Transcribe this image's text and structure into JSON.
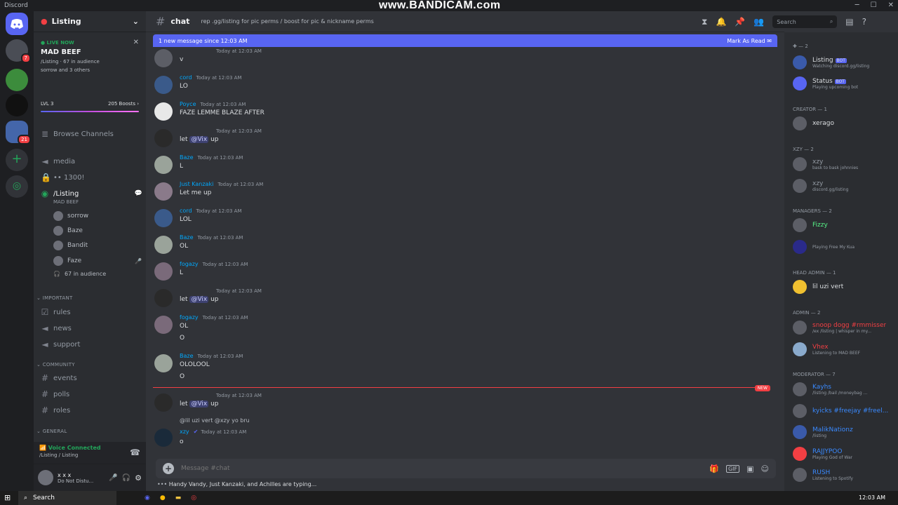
{
  "window": {
    "app_title": "Discord",
    "watermark": "www.BANDICAM.com"
  },
  "server_list": {
    "badges": [
      "7",
      "21"
    ]
  },
  "guild": {
    "name": "Listing"
  },
  "live_stage": {
    "tag": "LIVE NOW",
    "title": "MAD BEEF",
    "channel": "/Listing",
    "audience": "67 in audience",
    "speakers": "sorrow and 3 others"
  },
  "boost": {
    "level": "LVL 3",
    "boosts": "205 Boosts"
  },
  "channels": {
    "browse": "Browse Channels",
    "media": "media",
    "locked": "•• 1300!",
    "stage": "/Listing",
    "stage_sub": "MAD BEEF",
    "speakers": [
      "sorrow",
      "Baze",
      "Bandit",
      "Faze"
    ],
    "audience": "67 in audience",
    "cat_important": "IMPORTANT",
    "rules": "rules",
    "news": "news",
    "support": "support",
    "cat_community": "COMMUNITY",
    "events": "events",
    "polls": "polls",
    "roles": "roles",
    "cat_general": "GENERAL"
  },
  "voice_panel": {
    "status": "Voice Connected",
    "location": "/Listing / Listing"
  },
  "user_panel": {
    "name": "x x x",
    "status": "Do Not Distu..."
  },
  "chat": {
    "channel": "chat",
    "topic": "rep .gg/listing for pic perms / boost for pic & nickname perms",
    "new_messages": "1 new message since 12:03 AM",
    "mark_read": "Mark As Read",
    "new_tag": "NEW",
    "placeholder": "Message #chat",
    "typing": "Handy Vandy, Just Kanzaki, and Achilles are typing..."
  },
  "messages": [
    {
      "author": "",
      "time": "Today at 12:03 AM",
      "text": "v"
    },
    {
      "author": "cord",
      "time": "Today at 12:03 AM",
      "text": "LO"
    },
    {
      "author": "Poyce",
      "time": "Today at 12:03 AM",
      "text": "FAZE LEMME BLAZE AFTER"
    },
    {
      "author": "",
      "time": "Today at 12:03 AM",
      "text_pre": "let ",
      "mention": "@Vix",
      "text_post": " up"
    },
    {
      "author": "Baze",
      "time": "Today at 12:03 AM",
      "text": "L"
    },
    {
      "author": "Just Kanzaki",
      "time": "Today at 12:03 AM",
      "text": "Let me up"
    },
    {
      "author": "cord",
      "time": "Today at 12:03 AM",
      "text": "LOL"
    },
    {
      "author": "Baze",
      "time": "Today at 12:03 AM",
      "text": "OL"
    },
    {
      "author": "fogazy",
      "time": "Today at 12:03 AM",
      "text": "L"
    },
    {
      "author": "",
      "time": "Today at 12:03 AM",
      "text_pre": "let ",
      "mention": "@Vix",
      "text_post": " up"
    },
    {
      "author": "fogazy",
      "time": "Today at 12:03 AM",
      "text": "OL",
      "text2": "O"
    },
    {
      "author": "Baze",
      "time": "Today at 12:03 AM",
      "text": "OLOLOOL",
      "text2": "O"
    },
    {
      "author": "",
      "time": "Today at 12:03 AM",
      "text_pre": "let ",
      "mention": "@Vix",
      "text_post": " up"
    },
    {
      "author": "xzy",
      "time": "Today at 12:03 AM",
      "text": "o",
      "reply": "@lil uzi vert @xzy yo bru"
    }
  ],
  "search": {
    "placeholder": "Search"
  },
  "members": {
    "bots": [
      {
        "name": "Listing",
        "tag": "BOT",
        "status": "Watching discord.gg/listing"
      },
      {
        "name": "Status",
        "tag": "BOT",
        "status": "Playing upcoming bot"
      }
    ],
    "cat_creator": "CREATOR — 1",
    "creator": [
      {
        "name": "xerago",
        "status": ""
      }
    ],
    "cat_xzy": "XZY — 2",
    "xzy": [
      {
        "name": "xzy",
        "status": "bask to bask johnnies"
      },
      {
        "name": "xzy",
        "status": "discord.gg/listing"
      }
    ],
    "cat_managers": "MANAGERS — 2",
    "managers": [
      {
        "name": "Fizzy",
        "status": ""
      },
      {
        "name": "",
        "status": "Playing Free My Kua"
      }
    ],
    "cat_head_admin": "HEAD ADMIN — 1",
    "head_admin": [
      {
        "name": "lil uzi vert",
        "status": ""
      }
    ],
    "cat_admin": "ADMIN — 2",
    "admin": [
      {
        "name": "snoop dogg #rmmisser",
        "status": "/ex /listing | whisper in my..."
      },
      {
        "name": "Vhex",
        "status": "Listening to MAD BEEF"
      }
    ],
    "cat_moderator": "MODERATOR — 7",
    "moderators": [
      {
        "name": "Kayhs",
        "status": "/listing /bail /moneybag ..."
      },
      {
        "name": "kyicks #freejay #freel...",
        "status": ""
      },
      {
        "name": "MalikNationz",
        "status": "/listing"
      },
      {
        "name": "RAJJYPOO",
        "status": "Playing God of War"
      },
      {
        "name": "RUSH",
        "status": "Listening to Spotify"
      }
    ]
  },
  "taskbar": {
    "search": "Search",
    "time": "12:03 AM"
  },
  "colors": {
    "accent": "#5865f2",
    "online": "#23a55a",
    "dnd": "#f23f43",
    "link": "#00a8fc"
  }
}
